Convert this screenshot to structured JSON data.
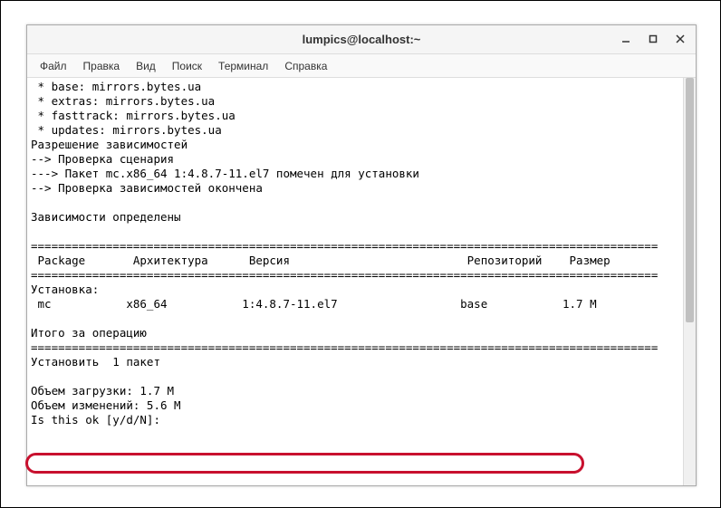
{
  "window": {
    "title": "lumpics@localhost:~"
  },
  "menubar": {
    "file": "Файл",
    "edit": "Правка",
    "view": "Вид",
    "search": "Поиск",
    "terminal": "Терминал",
    "help": "Справка"
  },
  "terminal": {
    "lines": [
      " * base: mirrors.bytes.ua",
      " * extras: mirrors.bytes.ua",
      " * fasttrack: mirrors.bytes.ua",
      " * updates: mirrors.bytes.ua",
      "Разрешение зависимостей",
      "--> Проверка сценария",
      "---> Пакет mc.x86_64 1:4.8.7-11.el7 помечен для установки",
      "--> Проверка зависимостей окончена",
      "",
      "Зависимости определены",
      "",
      "============================================================================================",
      " Package       Архитектура      Версия                          Репозиторий    Размер",
      "============================================================================================",
      "Установка:",
      " mc           x86_64           1:4.8.7-11.el7                  base           1.7 M",
      "",
      "Итого за операцию",
      "============================================================================================",
      "Установить  1 пакет",
      "",
      "Объем загрузки: 1.7 M",
      "Объем изменений: 5.6 M",
      "Is this ok [y/d/N]: "
    ]
  }
}
